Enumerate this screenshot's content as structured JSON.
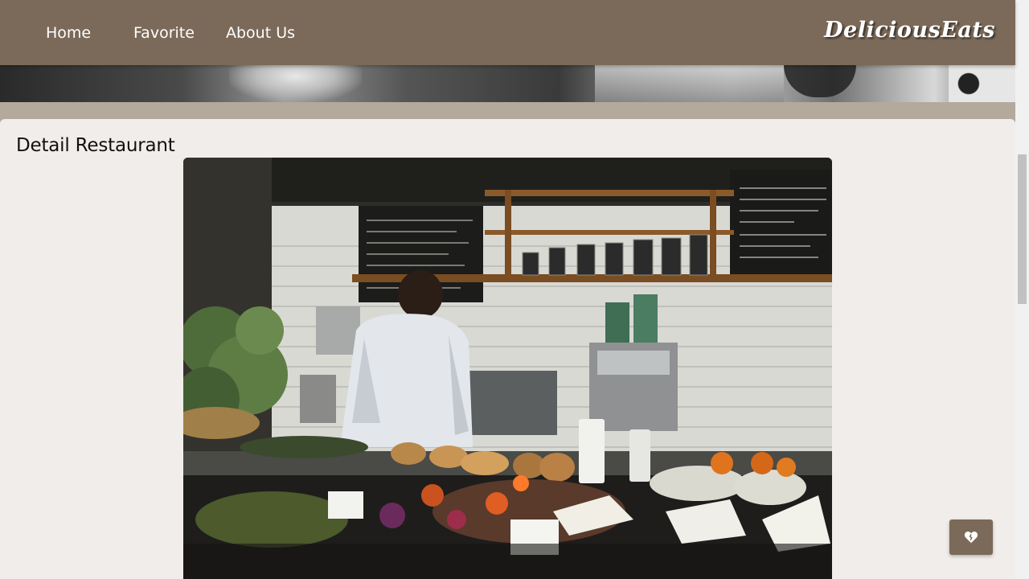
{
  "nav": {
    "items": [
      {
        "label": "Home"
      },
      {
        "label": "Favorite"
      },
      {
        "label": "About Us"
      }
    ],
    "brand": "DeliciousEats"
  },
  "main": {
    "title": "Detail Restaurant",
    "hero_image_icon": "restaurant-photo",
    "favorite_button_icon": "heart-icon"
  },
  "colors": {
    "navbar": "#7b6a59",
    "content_background": "#f1edea",
    "page_background": "#b3aa9c"
  }
}
